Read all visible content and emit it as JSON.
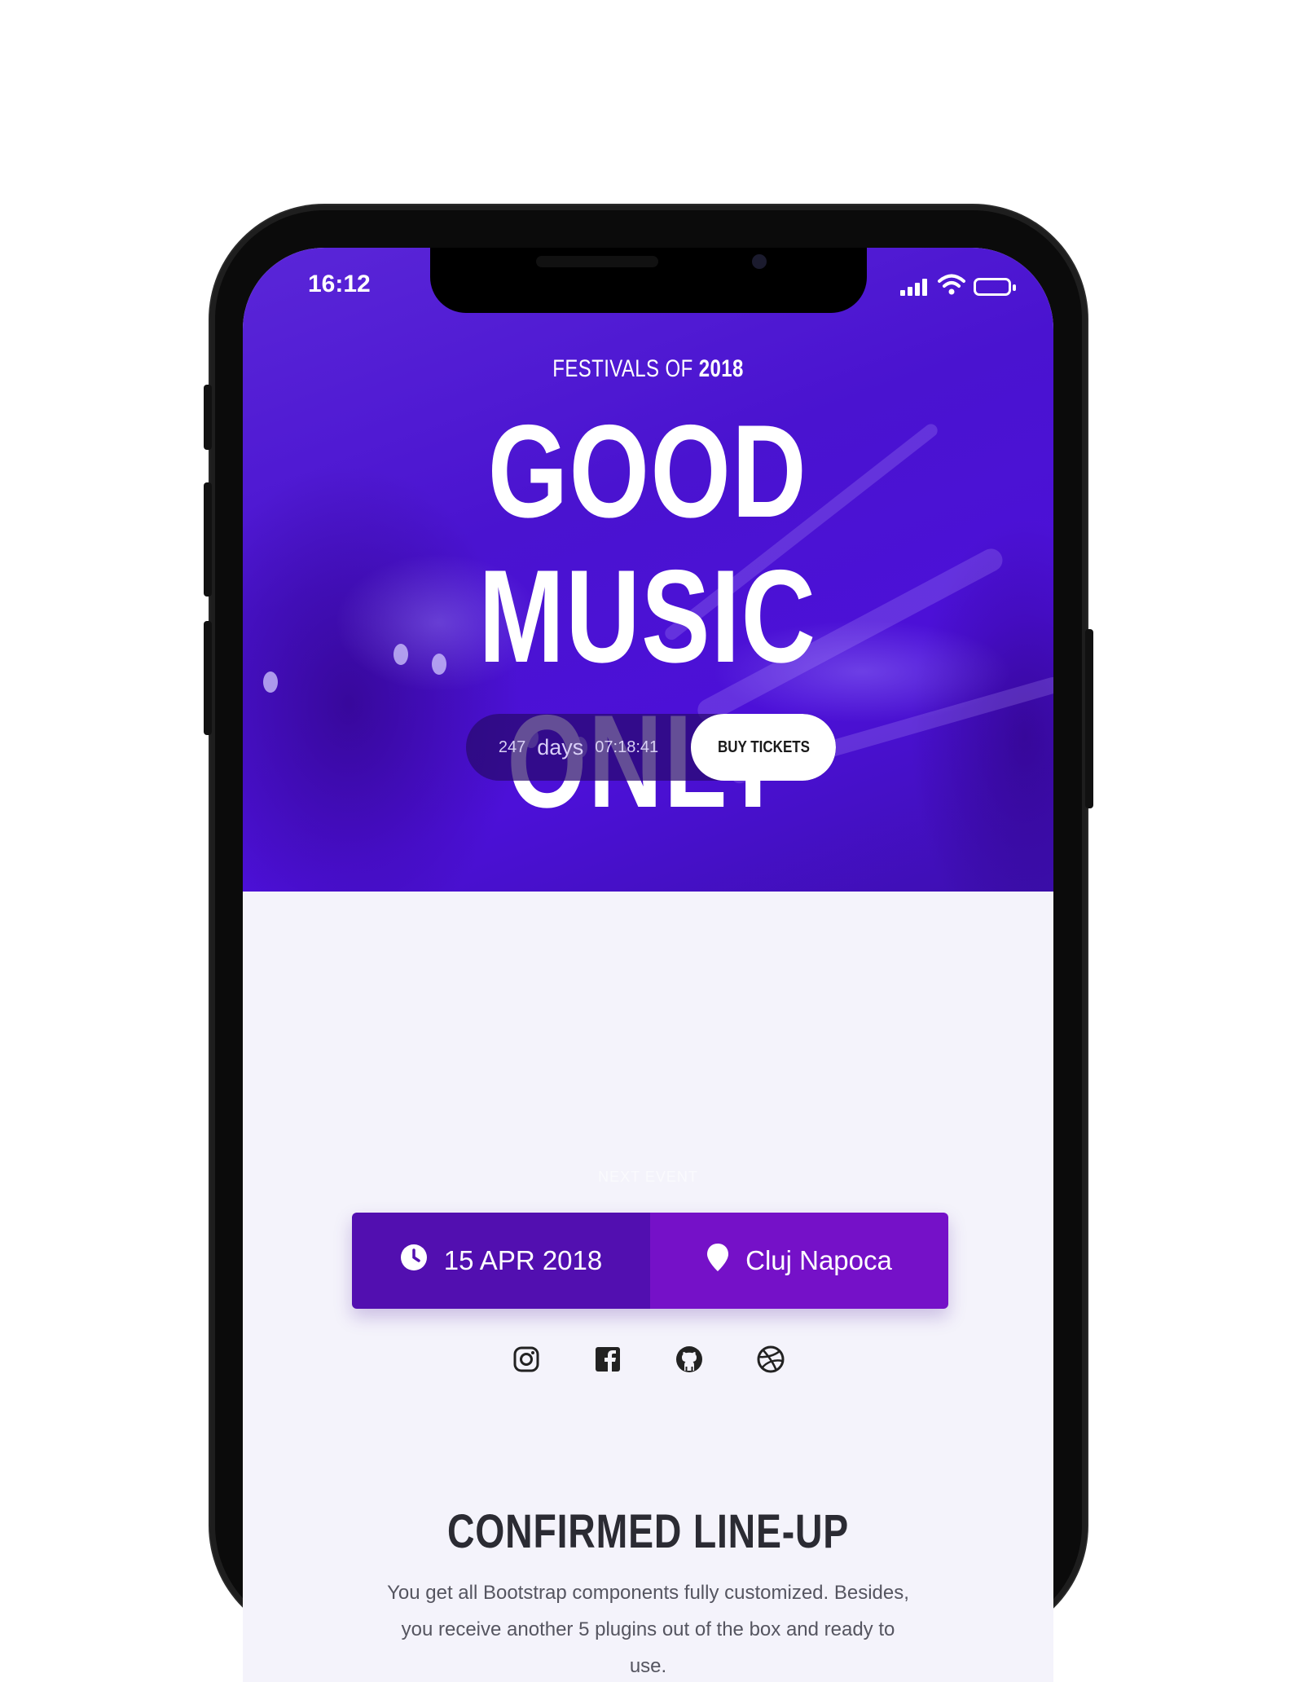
{
  "status_bar": {
    "time": "16:12"
  },
  "hero": {
    "kicker_prefix": "FESTIVALS OF",
    "kicker_year": "2018",
    "headline": "GOOD MUSIC ONLY",
    "countdown": {
      "days": "247",
      "days_label": "days",
      "time": "07:18:41"
    },
    "cta_label": "BUY TICKETS"
  },
  "next_event": {
    "label": "NEXT EVENT",
    "date": "15 APR 2018",
    "location": "Cluj Napoca"
  },
  "socials": [
    {
      "icon": "instagram-icon"
    },
    {
      "icon": "facebook-icon"
    },
    {
      "icon": "github-icon"
    },
    {
      "icon": "dribbble-icon"
    }
  ],
  "lineup": {
    "title": "CONFIRMED LINE-UP",
    "text": "You get all Bootstrap components fully customized. Besides, you receive another 5 plugins out of the box and ready to use."
  },
  "colors": {
    "hero": "#4a13d0",
    "date_bg": "#520fb0",
    "location_bg": "#7511c8",
    "page_bg": "#f4f3fb"
  }
}
